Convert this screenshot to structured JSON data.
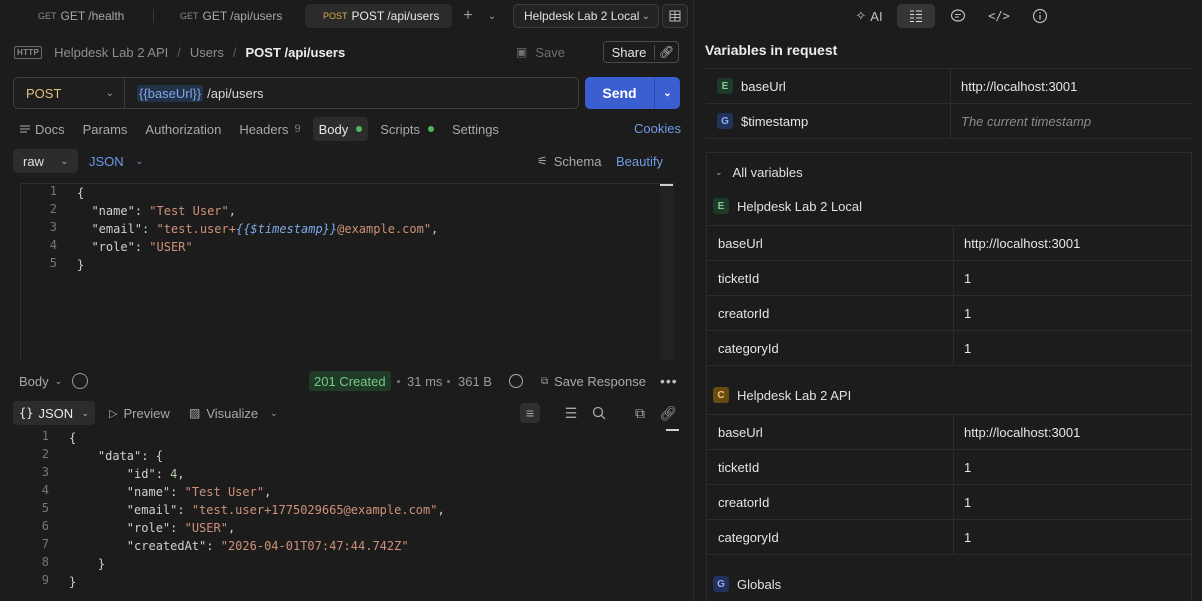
{
  "tabs": [
    {
      "method": "GET",
      "label": "GET /health"
    },
    {
      "method": "GET",
      "label": "GET /api/users"
    },
    {
      "method": "POST",
      "label": "POST /api/users",
      "active": true
    }
  ],
  "environment": {
    "selected": "Helpdesk Lab 2 Local"
  },
  "breadcrumb": {
    "icon_text": "HTTP",
    "collection": "Helpdesk Lab 2 API",
    "folder": "Users",
    "current": "POST /api/users"
  },
  "header_actions": {
    "save": "Save",
    "share": "Share"
  },
  "request": {
    "method": "POST",
    "url_var": "{{baseUrl}}",
    "url_path": "/api/users",
    "send": "Send"
  },
  "request_tabs": {
    "docs": "Docs",
    "params": "Params",
    "authorization": "Authorization",
    "headers": "Headers",
    "headers_count": "9",
    "body": "Body",
    "scripts": "Scripts",
    "settings": "Settings",
    "cookies": "Cookies"
  },
  "body_toolbar": {
    "mode": "raw",
    "language": "JSON",
    "schema": "Schema",
    "beautify": "Beautify"
  },
  "request_body": {
    "line_numbers": [
      "1",
      "2",
      "3",
      "4",
      "5"
    ],
    "name_key": "\"name\"",
    "name_value": "\"Test User\"",
    "email_key": "\"email\"",
    "email_prefix": "\"test.user+",
    "email_var": "{{$timestamp}}",
    "email_suffix": "@example.com\"",
    "role_key": "\"role\"",
    "role_value": "\"USER\""
  },
  "response": {
    "body_label": "Body",
    "status": "201 Created",
    "time": "31 ms",
    "size": "361 B",
    "save_response": "Save Response",
    "format": "JSON",
    "preview": "Preview",
    "visualize": "Visualize",
    "line_numbers": [
      "1",
      "2",
      "3",
      "4",
      "5",
      "6",
      "7",
      "8",
      "9"
    ],
    "data_key": "\"data\"",
    "id_key": "\"id\"",
    "id_value": "4",
    "name_key": "\"name\"",
    "name_value": "\"Test User\"",
    "email_key": "\"email\"",
    "email_value": "\"test.user+1775029665@example.com\"",
    "role_key": "\"role\"",
    "role_value": "\"USER\"",
    "created_key": "\"createdAt\"",
    "created_value": "\"2026-04-01T07:47:44.742Z\""
  },
  "right_toolbar": {
    "ai": "AI"
  },
  "variables_panel": {
    "title": "Variables in request",
    "in_request": [
      {
        "badge": "E",
        "name": "baseUrl",
        "value": "http://localhost:3001"
      },
      {
        "badge": "G",
        "name": "$timestamp",
        "value": "The current timestamp"
      }
    ],
    "all_variables_label": "All variables",
    "groups": [
      {
        "badge": "E",
        "name": "Helpdesk Lab 2 Local",
        "rows": [
          {
            "name": "baseUrl",
            "value": "http://localhost:3001"
          },
          {
            "name": "ticketId",
            "value": "1"
          },
          {
            "name": "creatorId",
            "value": "1"
          },
          {
            "name": "categoryId",
            "value": "1"
          }
        ]
      },
      {
        "badge": "C",
        "name": "Helpdesk Lab 2 API",
        "rows": [
          {
            "name": "baseUrl",
            "value": "http://localhost:3001"
          },
          {
            "name": "ticketId",
            "value": "1"
          },
          {
            "name": "creatorId",
            "value": "1"
          },
          {
            "name": "categoryId",
            "value": "1"
          }
        ]
      },
      {
        "badge": "G",
        "name": "Globals",
        "rows": []
      }
    ]
  },
  "colors": {
    "accent": "#3b5fd0",
    "link": "#6f9be6",
    "status_ok": "#78c98a",
    "method_post": "#e5c07b"
  }
}
